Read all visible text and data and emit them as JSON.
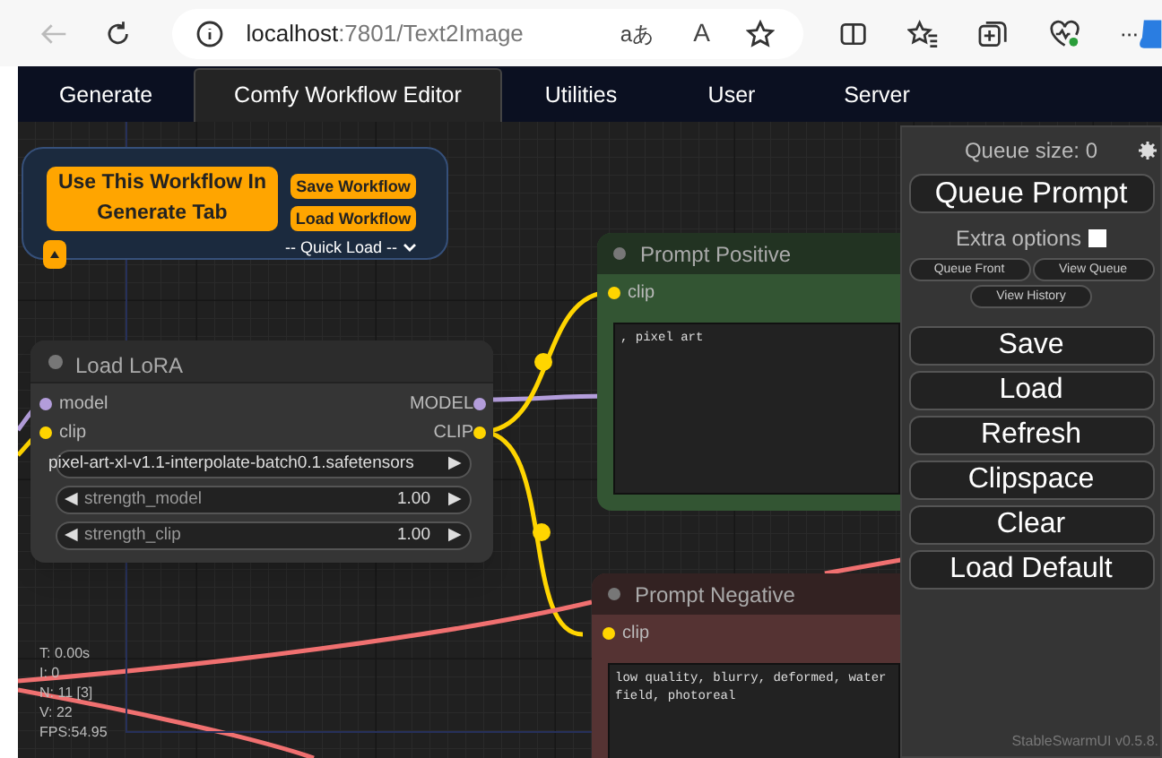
{
  "browser": {
    "url_host": "localhost",
    "url_path": ":7801/Text2Image",
    "translate_glyph": "aあ",
    "read_aloud_glyph": "A",
    "more_glyph": "···"
  },
  "tabs": [
    {
      "label": "Generate",
      "selected": false
    },
    {
      "label": "Comfy Workflow Editor",
      "selected": true
    },
    {
      "label": "Utilities",
      "selected": false
    },
    {
      "label": "User",
      "selected": false
    },
    {
      "label": "Server",
      "selected": false
    }
  ],
  "workflow_group": {
    "use_button": "Use This Workflow In Generate Tab",
    "save_button": "Save Workflow",
    "load_button": "Load Workflow",
    "quick_load": "-- Quick Load --"
  },
  "load_lora": {
    "title": "Load LoRA",
    "slots": [
      {
        "input": "model",
        "output": "MODEL",
        "color": "#b39ddb"
      },
      {
        "input": "clip",
        "output": "CLIP",
        "color": "#ffd500"
      }
    ],
    "widgets": [
      {
        "kind": "combo",
        "label": "pixel-art-xl-v1.1-interpolate-batch0.1.safetensors",
        "right_arrow": "▶"
      },
      {
        "kind": "number",
        "label": "strength_model",
        "value": "1.00",
        "left_arrow": "◀",
        "right_arrow": "▶"
      },
      {
        "kind": "number",
        "label": "strength_clip",
        "value": "1.00",
        "left_arrow": "◀",
        "right_arrow": "▶"
      }
    ]
  },
  "prompt_nodes": [
    {
      "kind": "positive",
      "title": "Prompt Positive",
      "input": "clip",
      "text": ", pixel art"
    },
    {
      "kind": "negative",
      "title": "Prompt Negative",
      "input": "clip",
      "text": "low quality, blurry, deformed, water\nfield, photoreal"
    }
  ],
  "stats": [
    "T: 0.00s",
    "I: 0",
    "N: 11 [3]",
    "V: 22",
    "FPS:54.95"
  ],
  "panel": {
    "queue_size": "Queue size: 0",
    "queue_button": "Queue Prompt",
    "extra_options": {
      "label": "Extra options",
      "checked": false
    },
    "small_buttons": [
      "Queue Front",
      "View Queue",
      "View History"
    ],
    "buttons": [
      "Save",
      "Load",
      "Refresh",
      "Clipspace",
      "Clear",
      "Load Default"
    ],
    "version": "StableSwarmUI v0.5.8."
  }
}
